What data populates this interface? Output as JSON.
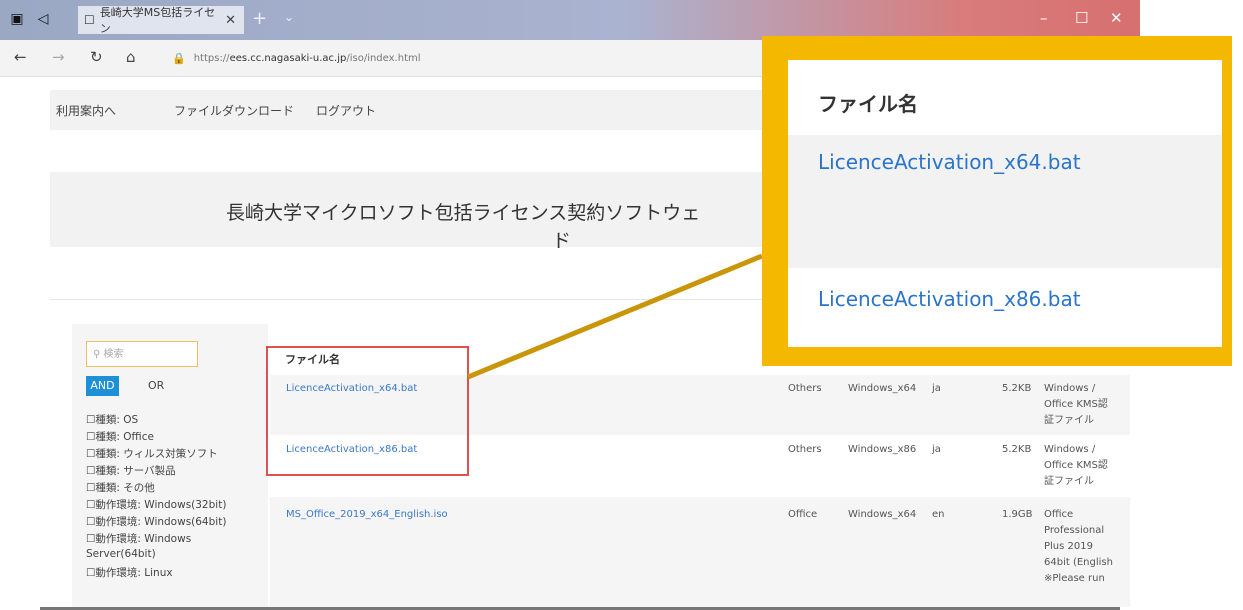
{
  "browser": {
    "tab_title": "長崎大学MS包括ライセン",
    "url_prefix": "https://",
    "url_host": "ees.cc.nagasaki-u.ac.jp",
    "url_path": "/iso/index.html"
  },
  "topnav": [
    "利用案内へ",
    "ファイルダウンロード",
    "ログアウト"
  ],
  "hero": {
    "title_line1": "長崎大学マイクロソフト包括ライセンス契約ソフトウェ",
    "title_line2": "ド"
  },
  "sidebar": {
    "search_placeholder": "検索",
    "and_label": "AND",
    "or_label": "OR",
    "filters": [
      "☐種類: OS",
      "☐種類: Office",
      "☐種類: ウィルス対策ソフト",
      "☐種類: サーバ製品",
      "☐種類: その他",
      "☐動作環境: Windows(32bit)",
      "☐動作環境: Windows(64bit)",
      "☐動作環境: Windows",
      "Server(64bit)",
      "☐動作環境: Linux"
    ]
  },
  "table": {
    "header_name": "ファイル名",
    "rows": [
      {
        "name": "LicenceActivation_x64.bat",
        "type": "Others",
        "os": "Windows_x64",
        "lang": "ja",
        "size": "5.2KB",
        "desc": [
          "Windows /",
          "Office KMS認",
          "証ファイル"
        ]
      },
      {
        "name": "LicenceActivation_x86.bat",
        "type": "Others",
        "os": "Windows_x86",
        "lang": "ja",
        "size": "5.2KB",
        "desc": [
          "Windows /",
          "Office KMS認",
          "証ファイル"
        ]
      },
      {
        "name": "MS_Office_2019_x64_English.iso",
        "type": "Office",
        "os": "Windows_x64",
        "lang": "en",
        "size": "1.9GB",
        "desc": [
          "Office",
          "Professional",
          "Plus 2019",
          "64bit (English",
          "※Please run"
        ]
      }
    ]
  },
  "callout": {
    "header": "ファイル名",
    "file1": "LicenceActivation_x64.bat",
    "file2": "LicenceActivation_x86.bat"
  },
  "colors": {
    "callout_border": "#f5b800",
    "highlight_box": "#e0504e",
    "link": "#2a75c9"
  }
}
